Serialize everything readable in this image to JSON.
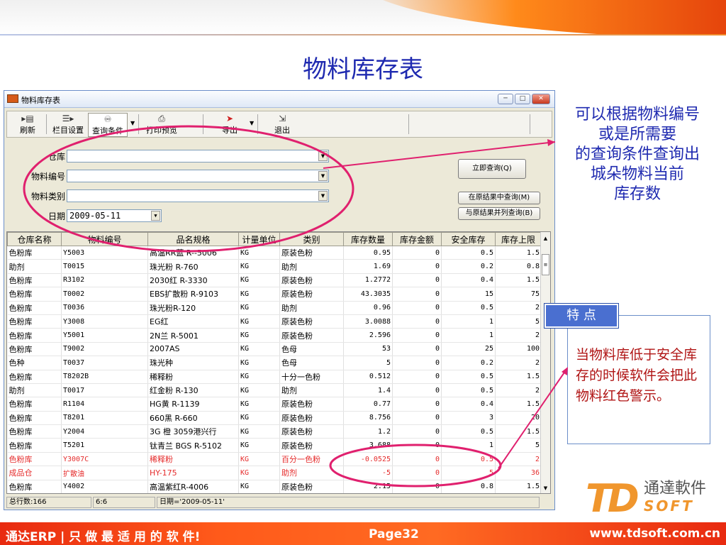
{
  "slide_title": "物料库存表",
  "window": {
    "title": "物料库存表",
    "controls": [
      "minimize-icon",
      "maximize-icon",
      "close-icon"
    ]
  },
  "toolbar": {
    "refresh": "刷新",
    "columns": "栏目设置",
    "query": "查询条件",
    "print": "打印预览",
    "export": "导出",
    "exit": "退出"
  },
  "form": {
    "warehouse_label": "仓库",
    "warehouse_value": "",
    "material_code_label": "物料编号",
    "material_code_value": "",
    "material_type_label": "物料类别",
    "material_type_value": "",
    "date_label": "日期",
    "date_value": "2009-05-11",
    "btn_query_now": "立即查询(Q)",
    "btn_query_in_result": "在原结果中查询(M)",
    "btn_query_parallel": "与原结果并列查询(B)"
  },
  "table": {
    "headers": [
      "仓库名称",
      "物料编号",
      "品名规格",
      "计量单位",
      "类别",
      "库存数量",
      "库存金额",
      "安全库存",
      "库存上限"
    ],
    "rows": [
      {
        "wh": "色粉库",
        "code": "Y5003",
        "name": "高温RR蓝  R--5006",
        "unit": "KG",
        "cat": "原装色粉",
        "qty": "0.95",
        "amt": "0",
        "safe": "0.5",
        "max": "1.5",
        "red": false
      },
      {
        "wh": "助剂",
        "code": "T0015",
        "name": "珠光粉  R-760",
        "unit": "KG",
        "cat": "助剂",
        "qty": "1.69",
        "amt": "0",
        "safe": "0.2",
        "max": "0.8",
        "red": false
      },
      {
        "wh": "色粉库",
        "code": "R3102",
        "name": "2030红  R-3330",
        "unit": "KG",
        "cat": "原装色粉",
        "qty": "1.2772",
        "amt": "0",
        "safe": "0.4",
        "max": "1.5",
        "red": false
      },
      {
        "wh": "色粉库",
        "code": "T0002",
        "name": "EBS扩散粉  R-9103",
        "unit": "KG",
        "cat": "原装色粉",
        "qty": "43.3035",
        "amt": "0",
        "safe": "15",
        "max": "75",
        "red": false
      },
      {
        "wh": "色粉库",
        "code": "T0036",
        "name": "珠光粉R-120",
        "unit": "KG",
        "cat": "助剂",
        "qty": "0.96",
        "amt": "0",
        "safe": "0.5",
        "max": "2",
        "red": false
      },
      {
        "wh": "色粉库",
        "code": "Y3008",
        "name": "EG红",
        "unit": "KG",
        "cat": "原装色粉",
        "qty": "3.0088",
        "amt": "0",
        "safe": "1",
        "max": "5",
        "red": false
      },
      {
        "wh": "色粉库",
        "code": "Y5001",
        "name": "2N兰  R-5001",
        "unit": "KG",
        "cat": "原装色粉",
        "qty": "2.596",
        "amt": "0",
        "safe": "1",
        "max": "2",
        "red": false
      },
      {
        "wh": "色粉库",
        "code": "T9002",
        "name": "2007AS",
        "unit": "KG",
        "cat": "色母",
        "qty": "53",
        "amt": "0",
        "safe": "25",
        "max": "100",
        "red": false
      },
      {
        "wh": "色种",
        "code": "T0037",
        "name": "珠光种",
        "unit": "KG",
        "cat": "色母",
        "qty": "5",
        "amt": "0",
        "safe": "0.2",
        "max": "2",
        "red": false
      },
      {
        "wh": "色粉库",
        "code": "T8202B",
        "name": "稀释粉",
        "unit": "KG",
        "cat": "十分一色粉",
        "qty": "0.512",
        "amt": "0",
        "safe": "0.5",
        "max": "1.5",
        "red": false
      },
      {
        "wh": "助剂",
        "code": "T0017",
        "name": "红金粉 R-130",
        "unit": "KG",
        "cat": "助剂",
        "qty": "1.4",
        "amt": "0",
        "safe": "0.5",
        "max": "2",
        "red": false
      },
      {
        "wh": "色粉库",
        "code": "R1104",
        "name": "HG黄  R-1139",
        "unit": "KG",
        "cat": "原装色粉",
        "qty": "0.77",
        "amt": "0",
        "safe": "0.4",
        "max": "1.5",
        "red": false
      },
      {
        "wh": "色粉库",
        "code": "T8201",
        "name": "660黑  R-660",
        "unit": "KG",
        "cat": "原装色粉",
        "qty": "8.756",
        "amt": "0",
        "safe": "3",
        "max": "20",
        "red": false
      },
      {
        "wh": "色粉库",
        "code": "Y2004",
        "name": "3G 橙  3059港兴行",
        "unit": "KG",
        "cat": "原装色粉",
        "qty": "1.2",
        "amt": "0",
        "safe": "0.5",
        "max": "1.5",
        "red": false
      },
      {
        "wh": "色粉库",
        "code": "T5201",
        "name": "钛青兰  BGS  R-5102",
        "unit": "KG",
        "cat": "原装色粉",
        "qty": "3.688",
        "amt": "0",
        "safe": "1",
        "max": "5",
        "red": false
      },
      {
        "wh": "色粉库",
        "code": "Y3007C",
        "name": "稀释粉",
        "unit": "KG",
        "cat": "百分一色粉",
        "qty": "-0.0525",
        "amt": "0",
        "safe": "0.5",
        "max": "2",
        "red": true
      },
      {
        "wh": "成品仓",
        "code": "扩散油",
        "name": "HY-175",
        "unit": "KG",
        "cat": "助剂",
        "qty": "-5",
        "amt": "0",
        "safe": "5",
        "max": "36",
        "red": true
      },
      {
        "wh": "色粉库",
        "code": "Y4002",
        "name": "高温紫红R-4006",
        "unit": "KG",
        "cat": "原装色粉",
        "qty": "2.15",
        "amt": "0",
        "safe": "0.8",
        "max": "1.5",
        "red": false
      }
    ]
  },
  "status": {
    "total": "总行数:166",
    "pos": "6:6",
    "filter": "日期='2009-05-11'"
  },
  "callout_top": [
    "可以根据物料编号",
    "或是所需要",
    "的查询条件查询出",
    "城朵物料当前",
    "库存数"
  ],
  "feature": {
    "tag": "特 点",
    "text": "当物料库低于安全库存的时候软件会把此物料红色警示。"
  },
  "logo": {
    "cn": "通達軟件",
    "mark": "TD",
    "soft": "SOFT"
  },
  "footer": {
    "left": "通达ERP | 只 做 最 适 用 的 软 件!",
    "page": "Page32",
    "url": "www.tdsoft.com.cn"
  },
  "colors": {
    "title_blue": "#1f2ab0",
    "alert_red": "#e52b2b",
    "orange": "#f0962d",
    "callout_magenta": "#e0206e"
  }
}
